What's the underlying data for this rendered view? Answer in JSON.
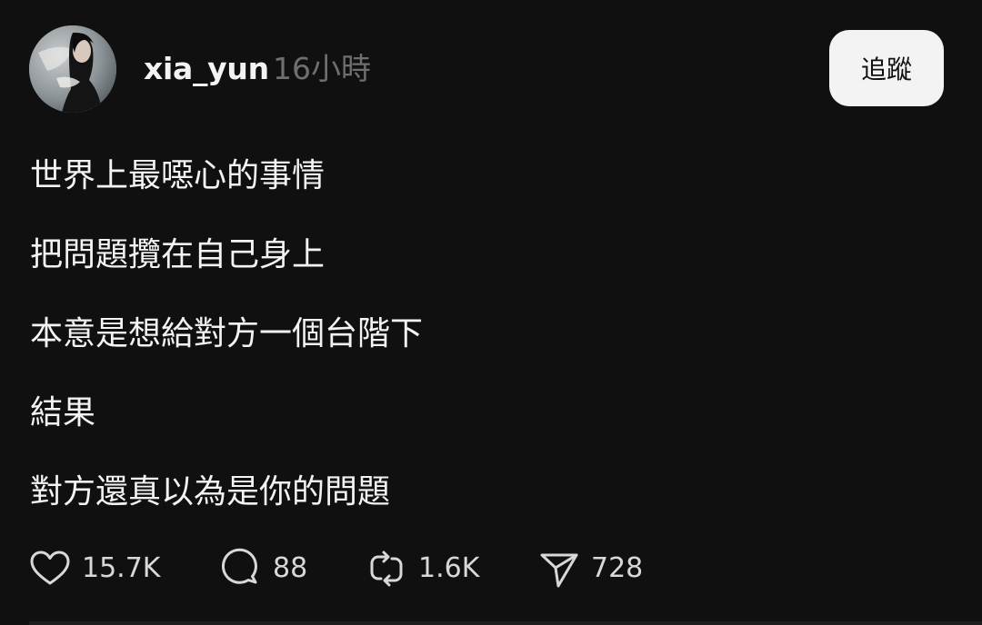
{
  "post": {
    "username": "xia_yun",
    "timestamp": "16小時",
    "follow_label": "追蹤",
    "lines": [
      "世界上最噁心的事情",
      "把問題攬在自己身上",
      "本意是想給對方一個台階下",
      "結果",
      "對方還真以為是你的問題"
    ],
    "actions": {
      "likes": "15.7K",
      "comments": "88",
      "reposts": "1.6K",
      "shares": "728"
    }
  },
  "icons": {
    "like": "heart-icon",
    "comment": "comment-bubble-icon",
    "repost": "repost-icon",
    "share": "send-icon"
  },
  "colors": {
    "background": "#101010",
    "text": "#f3f3f3",
    "muted": "#6f6f6f",
    "follow_button_bg": "#f3f3f3"
  }
}
